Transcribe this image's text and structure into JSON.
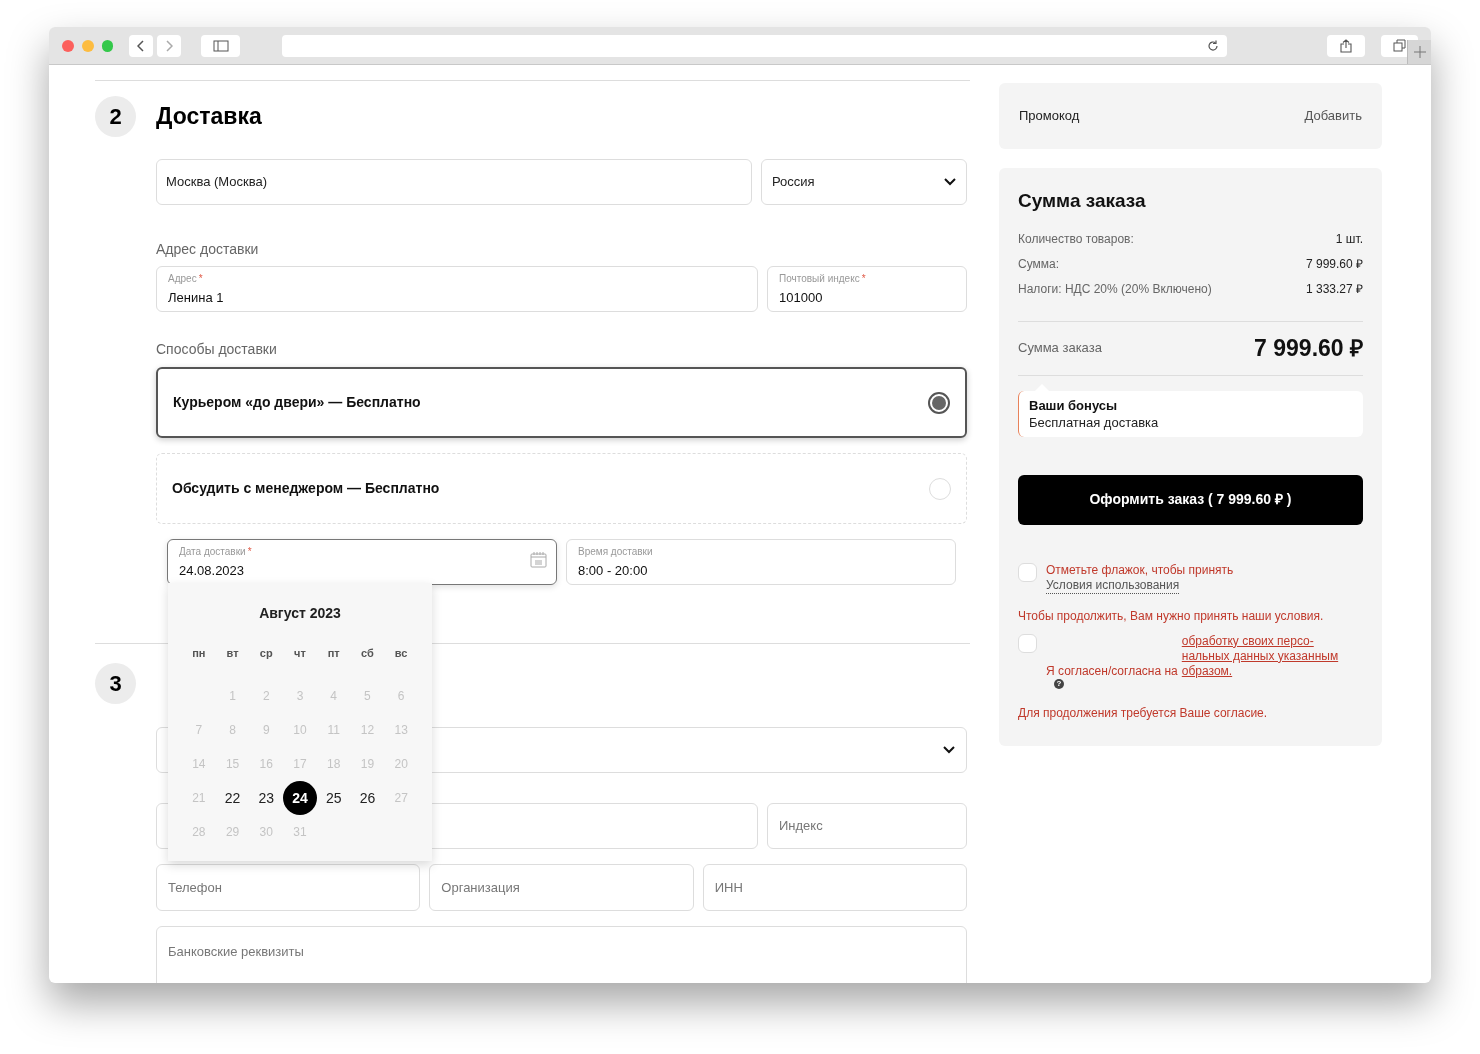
{
  "delivery": {
    "number": "2",
    "title": "Доставка",
    "city": "Москва (Москва)",
    "country": "Россия",
    "address_label": "Адрес доставки",
    "address_fields": [
      {
        "label": "Адрес",
        "required_mark": "*",
        "value": "Ленина 1"
      },
      {
        "label": "Почтовый индекс",
        "required_mark": "*",
        "value": "101000"
      }
    ],
    "methods_label": "Способы доставки",
    "methods": [
      {
        "label": "Курьером «до двери» — Бесплатно",
        "selected": true
      },
      {
        "label": "Обсудить с менеджером — Бесплатно",
        "selected": false
      }
    ],
    "date_field": {
      "label": "Дата доставки",
      "required_mark": "*",
      "value": "24.08.2023"
    },
    "time_field": {
      "label": "Время доставки",
      "value": "8:00 - 20:00"
    },
    "calendar": {
      "title": "Август 2023",
      "weekdays": [
        "пн",
        "вт",
        "ср",
        "чт",
        "пт",
        "сб",
        "вс"
      ],
      "weeks": [
        [
          {
            "day": "1",
            "available": false,
            "selected": false
          },
          {
            "day": "2",
            "available": false,
            "selected": false
          },
          {
            "day": "3",
            "available": false,
            "selected": false
          },
          {
            "day": "4",
            "available": false,
            "selected": false
          },
          {
            "day": "5",
            "available": false,
            "selected": false
          },
          {
            "day": "6",
            "available": false,
            "selected": false
          }
        ],
        [
          {
            "day": "7",
            "available": false,
            "selected": false
          },
          {
            "day": "8",
            "available": false,
            "selected": false
          },
          {
            "day": "9",
            "available": false,
            "selected": false
          },
          {
            "day": "10",
            "available": false,
            "selected": false
          },
          {
            "day": "11",
            "available": false,
            "selected": false
          },
          {
            "day": "12",
            "available": false,
            "selected": false
          },
          {
            "day": "13",
            "available": false,
            "selected": false
          }
        ],
        [
          {
            "day": "14",
            "available": false,
            "selected": false
          },
          {
            "day": "15",
            "available": false,
            "selected": false
          },
          {
            "day": "16",
            "available": false,
            "selected": false
          },
          {
            "day": "17",
            "available": false,
            "selected": false
          },
          {
            "day": "18",
            "available": false,
            "selected": false
          },
          {
            "day": "19",
            "available": false,
            "selected": false
          },
          {
            "day": "20",
            "available": false,
            "selected": false
          }
        ],
        [
          {
            "day": "21",
            "available": false,
            "selected": false
          },
          {
            "day": "22",
            "available": true,
            "selected": false
          },
          {
            "day": "23",
            "available": true,
            "selected": false
          },
          {
            "day": "24",
            "available": true,
            "selected": true
          },
          {
            "day": "25",
            "available": true,
            "selected": false
          },
          {
            "day": "26",
            "available": true,
            "selected": false
          },
          {
            "day": "27",
            "available": false,
            "selected": false
          }
        ],
        [
          {
            "day": "28",
            "available": false,
            "selected": false
          },
          {
            "day": "29",
            "available": false,
            "selected": false
          },
          {
            "day": "30",
            "available": false,
            "selected": false
          },
          {
            "day": "31",
            "available": false,
            "selected": false
          }
        ]
      ]
    }
  },
  "payment": {
    "number": "3",
    "placeholders": [
      "Индекс",
      "Телефон",
      "Организация",
      "ИНН",
      "Банковские реквизиты"
    ]
  },
  "promo": {
    "label": "Промокод",
    "action": "Добавить"
  },
  "summary": {
    "title": "Сумма заказа",
    "rows": [
      {
        "label": "Количество товаров:",
        "value": "1 шт."
      },
      {
        "label": "Сумма:",
        "value": "7 999.60 ₽"
      },
      {
        "label": "Налоги: НДС 20% (20% Включено)",
        "value": "1 333.27 ₽"
      }
    ],
    "total_label": "Сумма заказа",
    "total_value": "7 999.60 ₽",
    "bonus": {
      "title": "Ваши бонусы",
      "text": "Бесплатная доставка"
    },
    "submit": "Оформить заказ ( 7 999.60 ₽ )",
    "agreements": [
      {
        "checked": false,
        "text": "Отметьте флажок, чтобы принять ",
        "link": "Условия использования",
        "error": "Чтобы продолжить, Вам нужно принять наши условия."
      },
      {
        "checked": false,
        "text": "Я согласен/согласна на ",
        "link": "обработку своих персо-нальных данных указанным образом.",
        "help": "?",
        "error": "Для продолжения требуется Ваше согласие."
      }
    ]
  }
}
